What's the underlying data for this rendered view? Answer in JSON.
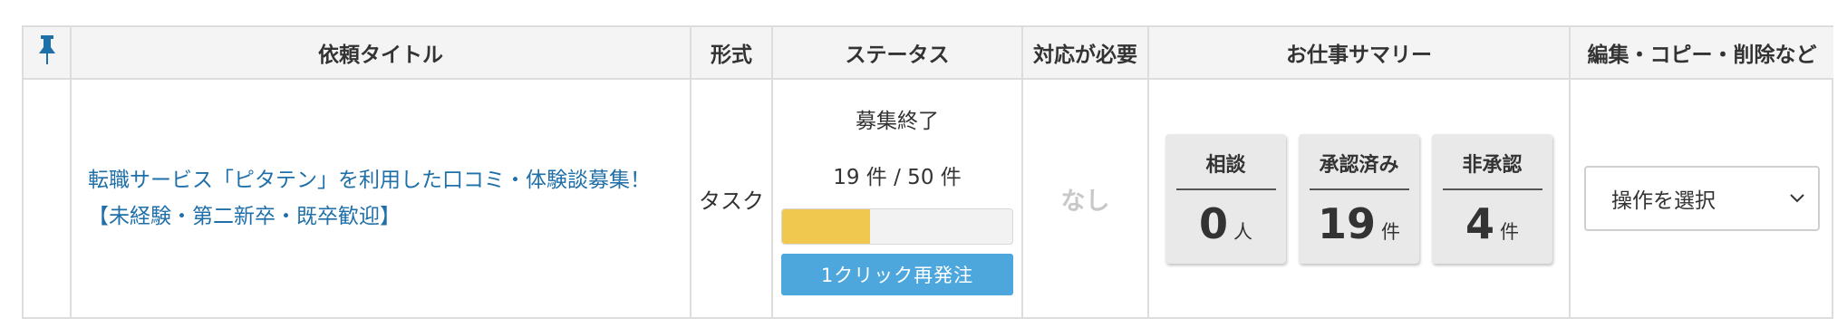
{
  "table": {
    "headers": {
      "pin_icon": "pin-icon",
      "title": "依頼タイトル",
      "format": "形式",
      "status": "ステータス",
      "action_required": "対応が必要",
      "summary": "お仕事サマリー",
      "edit": "編集・コピー・削除など"
    },
    "row": {
      "title_line1": "転職サービス「ピタテン」を利用した口コミ・体験談募集！",
      "title_line2": "【未経験・第二新卒・既卒歓迎】",
      "format": "タスク",
      "status_label": "募集終了",
      "count_text": "19 件 / 50 件",
      "progress_fraction": 0.38,
      "reorder_button": "1クリック再発注",
      "action_required": "なし",
      "summary": [
        {
          "label": "相談",
          "value": "0",
          "unit": "人"
        },
        {
          "label": "承認済み",
          "value": "19",
          "unit": "件"
        },
        {
          "label": "非承認",
          "value": "4",
          "unit": "件"
        }
      ],
      "action_select": "操作を選択",
      "action_select_icon": "chevron-down-icon"
    }
  },
  "colors": {
    "link": "#1f6fa8",
    "progress_fill": "#f0c84f",
    "button": "#4ea7dc",
    "pin": "#1f6fa8"
  }
}
